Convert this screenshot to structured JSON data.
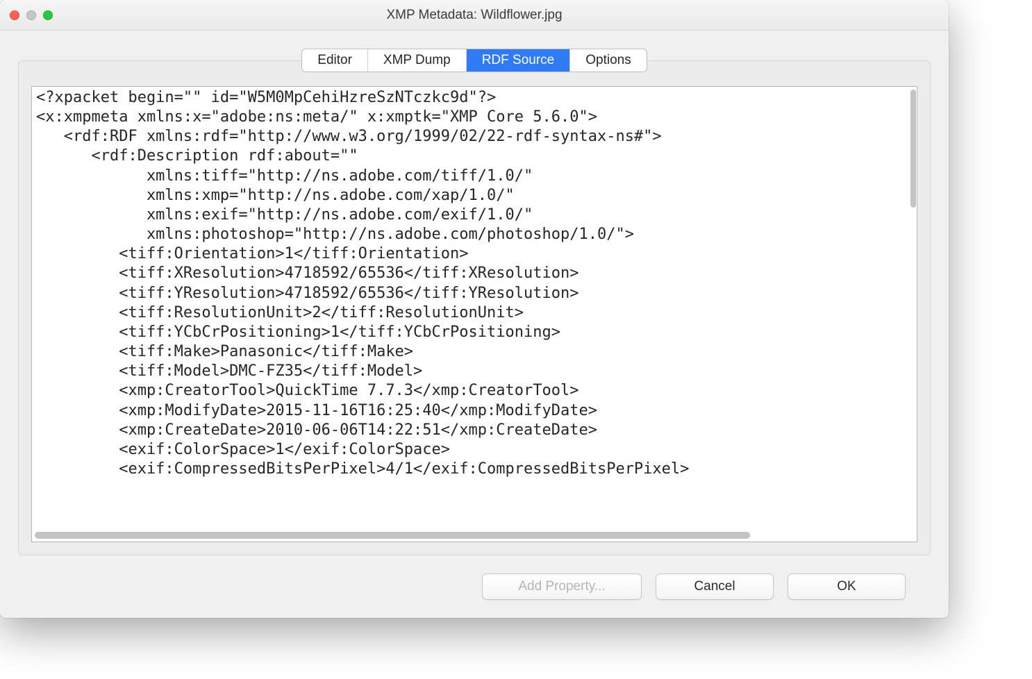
{
  "window": {
    "title": "XMP Metadata: Wildflower.jpg"
  },
  "tabs": {
    "editor": "Editor",
    "xmpdump": "XMP Dump",
    "rdfsource": "RDF Source",
    "options": "Options"
  },
  "source": "<?xpacket begin=\"\" id=\"W5M0MpCehiHzreSzNTczkc9d\"?>\n<x:xmpmeta xmlns:x=\"adobe:ns:meta/\" x:xmptk=\"XMP Core 5.6.0\">\n   <rdf:RDF xmlns:rdf=\"http://www.w3.org/1999/02/22-rdf-syntax-ns#\">\n      <rdf:Description rdf:about=\"\"\n            xmlns:tiff=\"http://ns.adobe.com/tiff/1.0/\"\n            xmlns:xmp=\"http://ns.adobe.com/xap/1.0/\"\n            xmlns:exif=\"http://ns.adobe.com/exif/1.0/\"\n            xmlns:photoshop=\"http://ns.adobe.com/photoshop/1.0/\">\n         <tiff:Orientation>1</tiff:Orientation>\n         <tiff:XResolution>4718592/65536</tiff:XResolution>\n         <tiff:YResolution>4718592/65536</tiff:YResolution>\n         <tiff:ResolutionUnit>2</tiff:ResolutionUnit>\n         <tiff:YCbCrPositioning>1</tiff:YCbCrPositioning>\n         <tiff:Make>Panasonic</tiff:Make>\n         <tiff:Model>DMC-FZ35</tiff:Model>\n         <xmp:CreatorTool>QuickTime 7.7.3</xmp:CreatorTool>\n         <xmp:ModifyDate>2015-11-16T16:25:40</xmp:ModifyDate>\n         <xmp:CreateDate>2010-06-06T14:22:51</xmp:CreateDate>\n         <exif:ColorSpace>1</exif:ColorSpace>\n         <exif:CompressedBitsPerPixel>4/1</exif:CompressedBitsPerPixel>",
  "buttons": {
    "add": "Add Property...",
    "cancel": "Cancel",
    "ok": "OK"
  }
}
